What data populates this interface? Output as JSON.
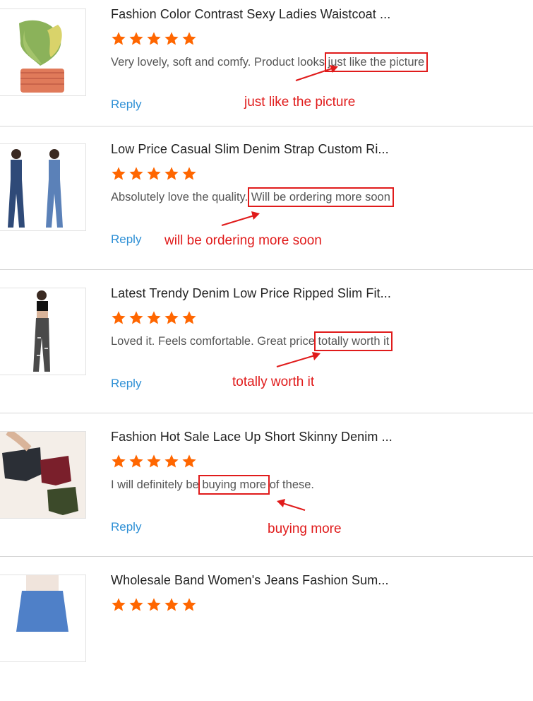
{
  "reviews": [
    {
      "title": "Fashion Color Contrast Sexy Ladies Waistcoat ...",
      "comment_pre": "Very lovely, soft and comfy. Product looks ",
      "comment_highlight": "just like the picture",
      "comment_post": "",
      "reply": "Reply",
      "annotation": "just like the picture",
      "rating": 5,
      "product_image": "green-yellow-crop-top-image"
    },
    {
      "title": "Low Price Casual Slim Denim Strap Custom Ri...",
      "comment_pre": " Absolutely love the quality. ",
      "comment_highlight": "Will be ordering more soon",
      "comment_post": "",
      "reply": "Reply",
      "annotation": "will be ordering more soon",
      "rating": 5,
      "product_image": "denim-overalls-image"
    },
    {
      "title": "Latest Trendy Denim Low Price Ripped Slim Fit...",
      "comment_pre": "Loved it. Feels comfortable. Great price ",
      "comment_highlight": "totally worth it",
      "comment_post": "",
      "reply": "Reply",
      "annotation": "totally worth it",
      "rating": 5,
      "product_image": "ripped-jeans-image"
    },
    {
      "title": "Fashion Hot Sale Lace Up Short Skinny Denim ...",
      "comment_pre": "I will definitely be ",
      "comment_highlight": "buying more",
      "comment_post": " of these.",
      "reply": "Reply",
      "annotation": "buying more",
      "rating": 5,
      "product_image": "lace-up-shorts-image"
    },
    {
      "title": "Wholesale Band Women's Jeans Fashion Sum...",
      "rating": 5,
      "product_image": "blue-jeans-image"
    }
  ],
  "colors": {
    "star": "#ff6600",
    "reply": "#2d8fd5",
    "annotation": "#e01b1b"
  }
}
